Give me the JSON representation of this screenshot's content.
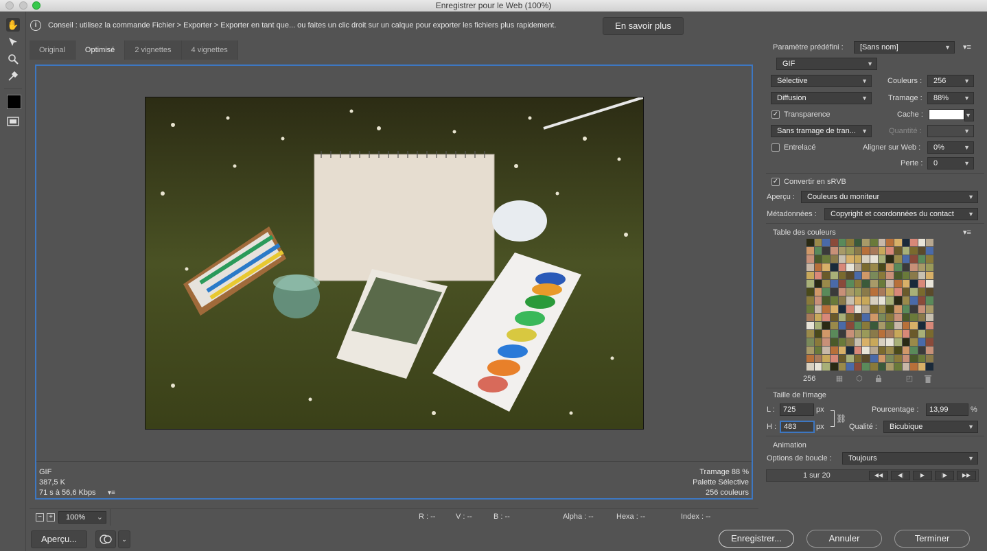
{
  "window": {
    "title": "Enregistrer pour le Web (100%)"
  },
  "tip": {
    "text": "Conseil : utilisez la commande Fichier > Exporter > Exporter en tant que... ou faites un clic droit sur un calque pour exporter les fichiers plus rapidement.",
    "learn_more": "En savoir plus"
  },
  "tabs": [
    {
      "label": "Original"
    },
    {
      "label": "Optimisé"
    },
    {
      "label": "2 vignettes"
    },
    {
      "label": "4 vignettes"
    }
  ],
  "preview_info": {
    "format": "GIF",
    "size": "387,5 K",
    "time": "71 s à 56,6 Kbps",
    "dither": "Tramage 88 %",
    "palette": "Palette Sélective",
    "colors": "256 couleurs"
  },
  "status": {
    "zoom": "100%",
    "r": "R : --",
    "v": "V : --",
    "b": "B : --",
    "alpha": "Alpha : --",
    "hexa": "Hexa : --",
    "index": "Index : --"
  },
  "buttons": {
    "apercu": "Aperçu...",
    "enregistrer": "Enregistrer...",
    "annuler": "Annuler",
    "terminer": "Terminer"
  },
  "panel": {
    "preset_label": "Paramètre prédéfini :",
    "preset_value": "[Sans nom]",
    "format_value": "GIF",
    "reduction_value": "Sélective",
    "couleurs_label": "Couleurs :",
    "couleurs_value": "256",
    "dither_algo_value": "Diffusion",
    "tramage_label": "Tramage :",
    "tramage_value": "88%",
    "transparence_label": "Transparence",
    "cache_label": "Cache :",
    "transp_dither_value": "Sans tramage de tran...",
    "quantite_label": "Quantité :",
    "entrelace_label": "Entrelacé",
    "web_snap_label": "Aligner sur Web :",
    "web_snap_value": "0%",
    "perte_label": "Perte :",
    "perte_value": "0",
    "srgb_label": "Convertir en sRVB",
    "apercu_label": "Aperçu :",
    "apercu_value": "Couleurs du moniteur",
    "metadata_label": "Métadonnées :",
    "metadata_value": "Copyright et coordonnées du contact",
    "color_table_label": "Table des couleurs",
    "color_count": "256",
    "image_size_label": "Taille de l'image",
    "width_label": "L :",
    "width_value": "725",
    "height_label": "H :",
    "height_value": "483",
    "px": "px",
    "percent_label": "Pourcentage :",
    "percent_value": "13,99",
    "percent_unit": "%",
    "quality_label": "Qualité :",
    "quality_value": "Bicubique",
    "animation_label": "Animation",
    "loop_label": "Options de boucle :",
    "loop_value": "Toujours",
    "frame_counter": "1 sur 20"
  },
  "checkboxes": {
    "transparence": true,
    "entrelace": false,
    "srgb": true
  },
  "palette_colors": [
    "#7a6a2e",
    "#a89a68",
    "#e8e4d8",
    "#8a7a3a",
    "#c8a85a",
    "#d09868",
    "#b8703a",
    "#9a8a4a",
    "#6a7a3a",
    "#a8b078",
    "#c89078",
    "#d88878",
    "#5a8a5a",
    "#d8b068",
    "#4a6aa8",
    "#8a7a4a"
  ]
}
